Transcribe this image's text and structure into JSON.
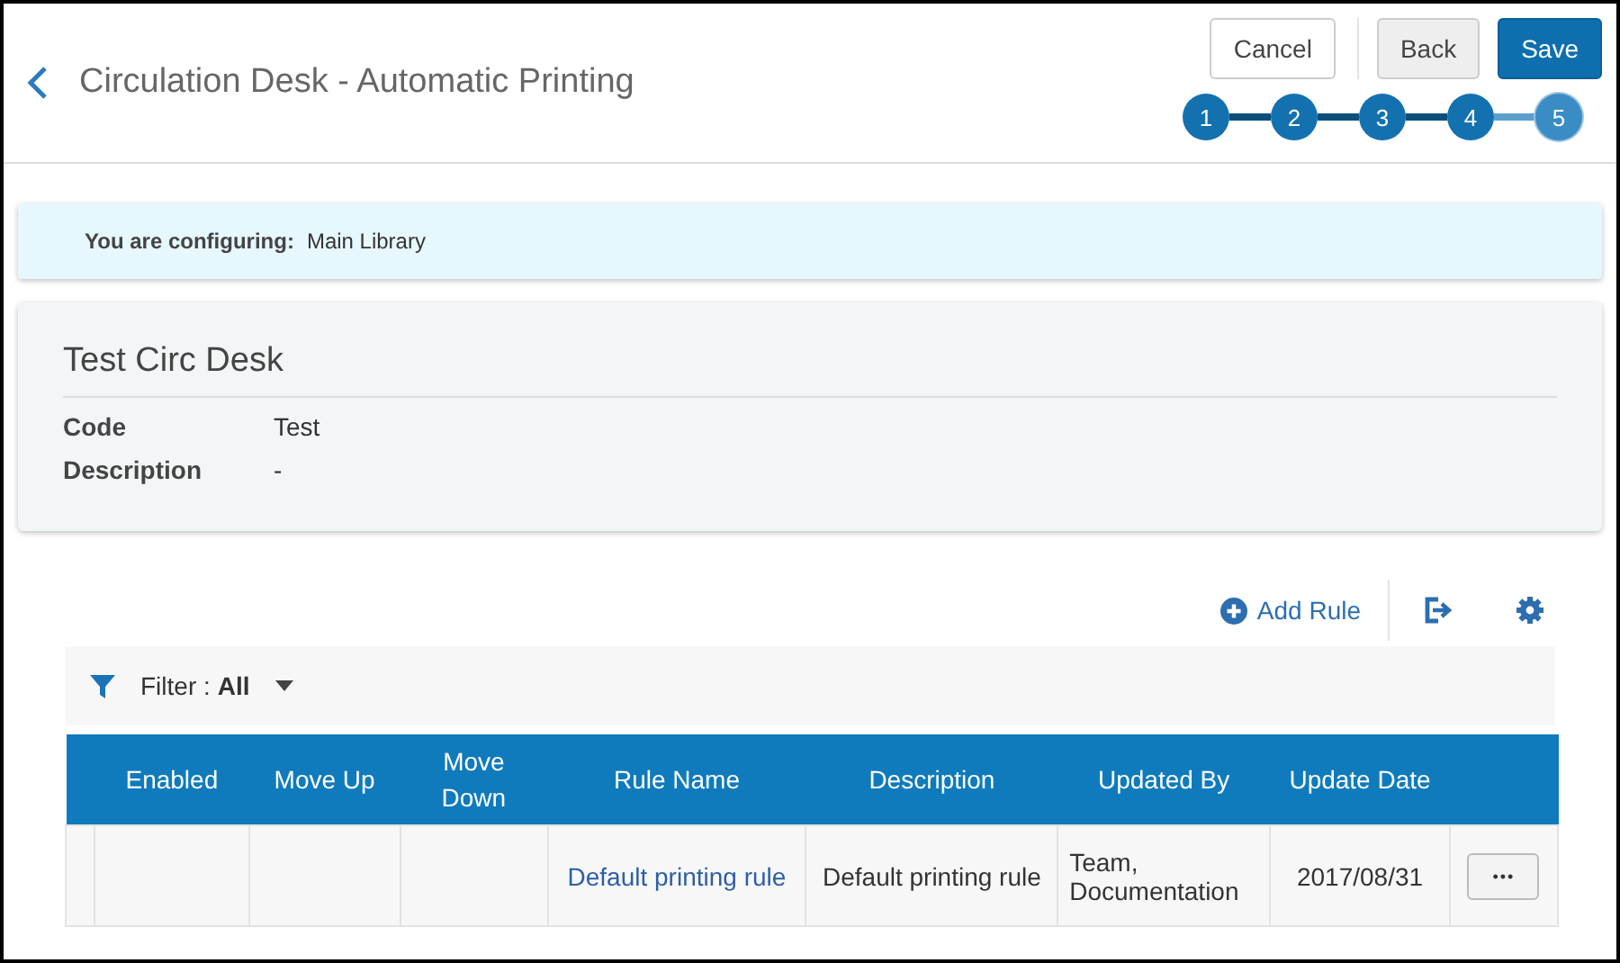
{
  "header": {
    "title": "Circulation Desk - Automatic Printing",
    "buttons": [
      {
        "label": "Cancel",
        "kind": "outline"
      },
      {
        "label": "Back",
        "kind": "grey"
      },
      {
        "label": "Save",
        "kind": "primary"
      }
    ],
    "steps": [
      {
        "label": "1",
        "selected": false
      },
      {
        "label": "2",
        "selected": false
      },
      {
        "label": "3",
        "selected": false
      },
      {
        "label": "4",
        "selected": false
      },
      {
        "label": "5",
        "selected": true
      }
    ]
  },
  "context": {
    "label": "You are configuring:",
    "value": "Main Library"
  },
  "details": {
    "title": "Test Circ Desk",
    "fields": [
      {
        "label": "Code",
        "value": "Test"
      },
      {
        "label": "Description",
        "value": "-"
      }
    ]
  },
  "toolbar": {
    "add_label": "Add Rule"
  },
  "filter": {
    "label": "Filter :",
    "value": "All"
  },
  "table": {
    "columns": [
      "Enabled",
      "Move Up",
      "Move Down",
      "Rule Name",
      "Description",
      "Updated By",
      "Update Date"
    ],
    "rows": [
      {
        "cells": [
          "",
          "",
          "",
          "Default printing rule",
          "Default printing rule",
          "Team, Documentation",
          "2017/08/31"
        ],
        "actions": "•••"
      }
    ]
  }
}
